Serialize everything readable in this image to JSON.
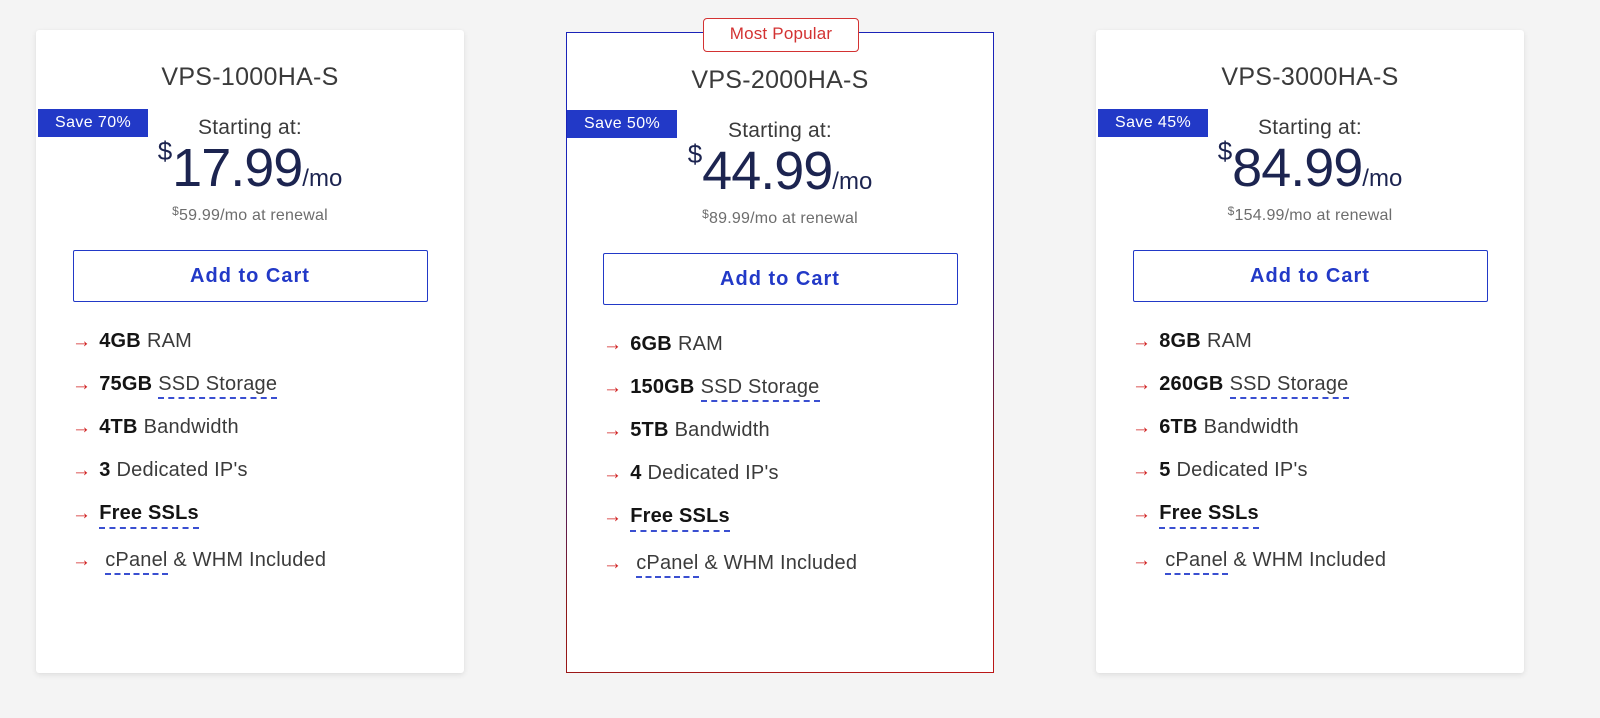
{
  "page": {
    "background_color": "#f4f4f4",
    "accent_blue": "#2239c7",
    "accent_red": "#d01f1f",
    "price_navy": "#1c2450"
  },
  "badges": {
    "most_popular": "Most Popular"
  },
  "labels": {
    "starting_at": "Starting at:",
    "add_to_cart": "Add to Cart",
    "currency": "$",
    "period": "/mo",
    "arrow": "→"
  },
  "plans": [
    {
      "name": "VPS-1000HA-S",
      "save_badge": "Save 70%",
      "starting_at": "Starting at:",
      "currency": "$",
      "price": "17.99",
      "period": "/mo",
      "renewal_currency": "$",
      "renewal": "59.99/mo at renewal",
      "cta": "Add to Cart",
      "featured": false,
      "features": [
        {
          "value": "4GB",
          "text": "RAM",
          "underline": false,
          "bold_all": false
        },
        {
          "value": "75GB",
          "text": "SSD Storage",
          "underline": true,
          "bold_all": false
        },
        {
          "value": "4TB",
          "text": "Bandwidth",
          "underline": false,
          "bold_all": false
        },
        {
          "value": "3",
          "text": "Dedicated IP's",
          "underline": false,
          "bold_all": false
        },
        {
          "value": "Free SSLs",
          "text": "",
          "underline": true,
          "bold_all": true
        },
        {
          "value": "",
          "text": "cPanel",
          "text2": " & WHM Included",
          "underline": true,
          "bold_all": false
        }
      ]
    },
    {
      "name": "VPS-2000HA-S",
      "save_badge": "Save 50%",
      "starting_at": "Starting at:",
      "currency": "$",
      "price": "44.99",
      "period": "/mo",
      "renewal_currency": "$",
      "renewal": "89.99/mo at renewal",
      "cta": "Add to Cart",
      "featured": true,
      "features": [
        {
          "value": "6GB",
          "text": "RAM",
          "underline": false,
          "bold_all": false
        },
        {
          "value": "150GB",
          "text": "SSD Storage",
          "underline": true,
          "bold_all": false
        },
        {
          "value": "5TB",
          "text": "Bandwidth",
          "underline": false,
          "bold_all": false
        },
        {
          "value": "4",
          "text": "Dedicated IP's",
          "underline": false,
          "bold_all": false
        },
        {
          "value": "Free SSLs",
          "text": "",
          "underline": true,
          "bold_all": true
        },
        {
          "value": "",
          "text": "cPanel",
          "text2": " & WHM Included",
          "underline": true,
          "bold_all": false
        }
      ]
    },
    {
      "name": "VPS-3000HA-S",
      "save_badge": "Save 45%",
      "starting_at": "Starting at:",
      "currency": "$",
      "price": "84.99",
      "period": "/mo",
      "renewal_currency": "$",
      "renewal": "154.99/mo at renewal",
      "cta": "Add to Cart",
      "featured": false,
      "features": [
        {
          "value": "8GB",
          "text": "RAM",
          "underline": false,
          "bold_all": false
        },
        {
          "value": "260GB",
          "text": "SSD Storage",
          "underline": true,
          "bold_all": false
        },
        {
          "value": "6TB",
          "text": "Bandwidth",
          "underline": false,
          "bold_all": false
        },
        {
          "value": "5",
          "text": "Dedicated IP's",
          "underline": false,
          "bold_all": false
        },
        {
          "value": "Free SSLs",
          "text": "",
          "underline": true,
          "bold_all": true
        },
        {
          "value": "",
          "text": "cPanel",
          "text2": " & WHM Included",
          "underline": true,
          "bold_all": false
        }
      ]
    }
  ]
}
